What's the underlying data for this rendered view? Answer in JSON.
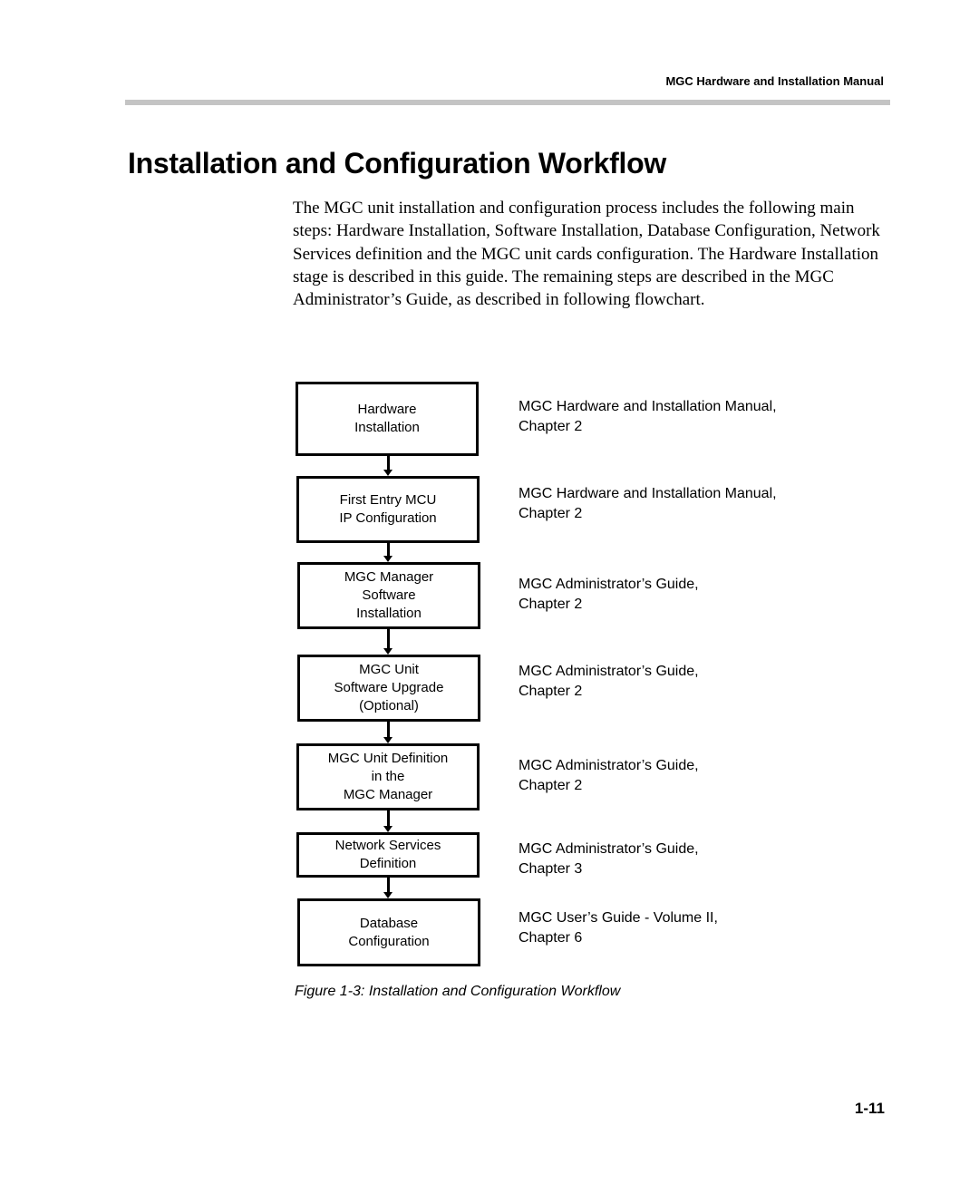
{
  "header": {
    "running_title": "MGC Hardware and Installation Manual"
  },
  "section": {
    "title": "Installation and Configuration Workflow",
    "intro": "The MGC unit installation and configuration process includes the following main steps: Hardware Installation, Software Installation, Database Configuration, Network Services definition and the MGC unit cards configuration. The Hardware Installation stage is described in this guide. The remaining steps are described in the MGC Administrator’s Guide, as described in following flowchart."
  },
  "flowchart": {
    "steps": [
      {
        "lines": [
          "Hardware",
          "Installation"
        ],
        "reference": [
          "MGC Hardware and Installation Manual,",
          "Chapter 2"
        ]
      },
      {
        "lines": [
          "First Entry MCU",
          "IP Configuration"
        ],
        "reference": [
          "MGC Hardware and Installation Manual,",
          "Chapter 2"
        ]
      },
      {
        "lines": [
          "MGC Manager",
          "Software",
          "Installation"
        ],
        "reference": [
          "MGC Administrator’s Guide,",
          "Chapter 2"
        ]
      },
      {
        "lines": [
          "MGC Unit",
          "Software Upgrade",
          "(Optional)"
        ],
        "reference": [
          "MGC Administrator’s Guide,",
          "Chapter 2"
        ]
      },
      {
        "lines": [
          "MGC Unit Definition",
          "in the",
          "MGC Manager"
        ],
        "reference": [
          "MGC Administrator’s Guide,",
          "Chapter 2"
        ]
      },
      {
        "lines": [
          "Network Services",
          "Definition"
        ],
        "reference": [
          "MGC Administrator’s Guide,",
          "Chapter 3"
        ]
      },
      {
        "lines": [
          "Database",
          "Configuration"
        ],
        "reference": [
          "MGC User’s Guide - Volume II,",
          "Chapter 6"
        ]
      }
    ],
    "caption": "Figure 1-3: Installation and Configuration Workflow"
  },
  "footer": {
    "page_number": "1-11"
  }
}
